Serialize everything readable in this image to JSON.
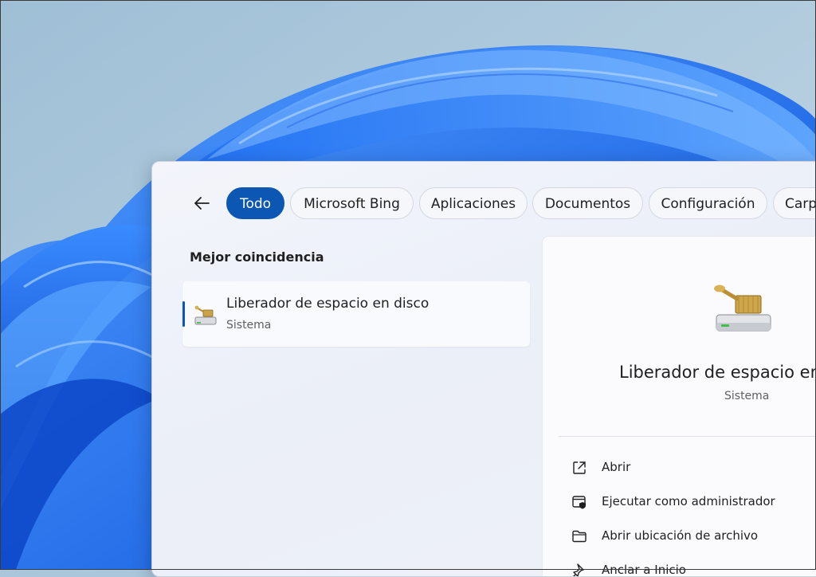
{
  "search": {
    "filters": [
      {
        "label": "Todo",
        "active": true
      },
      {
        "label": "Microsoft Bing",
        "active": false
      },
      {
        "label": "Aplicaciones",
        "active": false
      },
      {
        "label": "Documentos",
        "active": false
      },
      {
        "label": "Configuración",
        "active": false
      },
      {
        "label": "Carpetas",
        "active": false
      }
    ],
    "best_match_title": "Mejor coincidencia",
    "best_match": {
      "name": "Liberador de espacio en disco",
      "type": "Sistema"
    }
  },
  "detail": {
    "name": "Liberador de espacio en disco",
    "type": "Sistema",
    "actions": [
      {
        "label": "Abrir",
        "icon": "open-external-icon"
      },
      {
        "label": "Ejecutar como administrador",
        "icon": "run-as-admin-icon"
      },
      {
        "label": "Abrir ubicación de archivo",
        "icon": "folder-icon"
      },
      {
        "label": "Anclar a Inicio",
        "icon": "pin-icon"
      }
    ]
  },
  "colors": {
    "accent": "#0c56b4",
    "wallpaper_bg": "#a9c6dc",
    "wallpaper_blue": "#1a6cf0"
  }
}
